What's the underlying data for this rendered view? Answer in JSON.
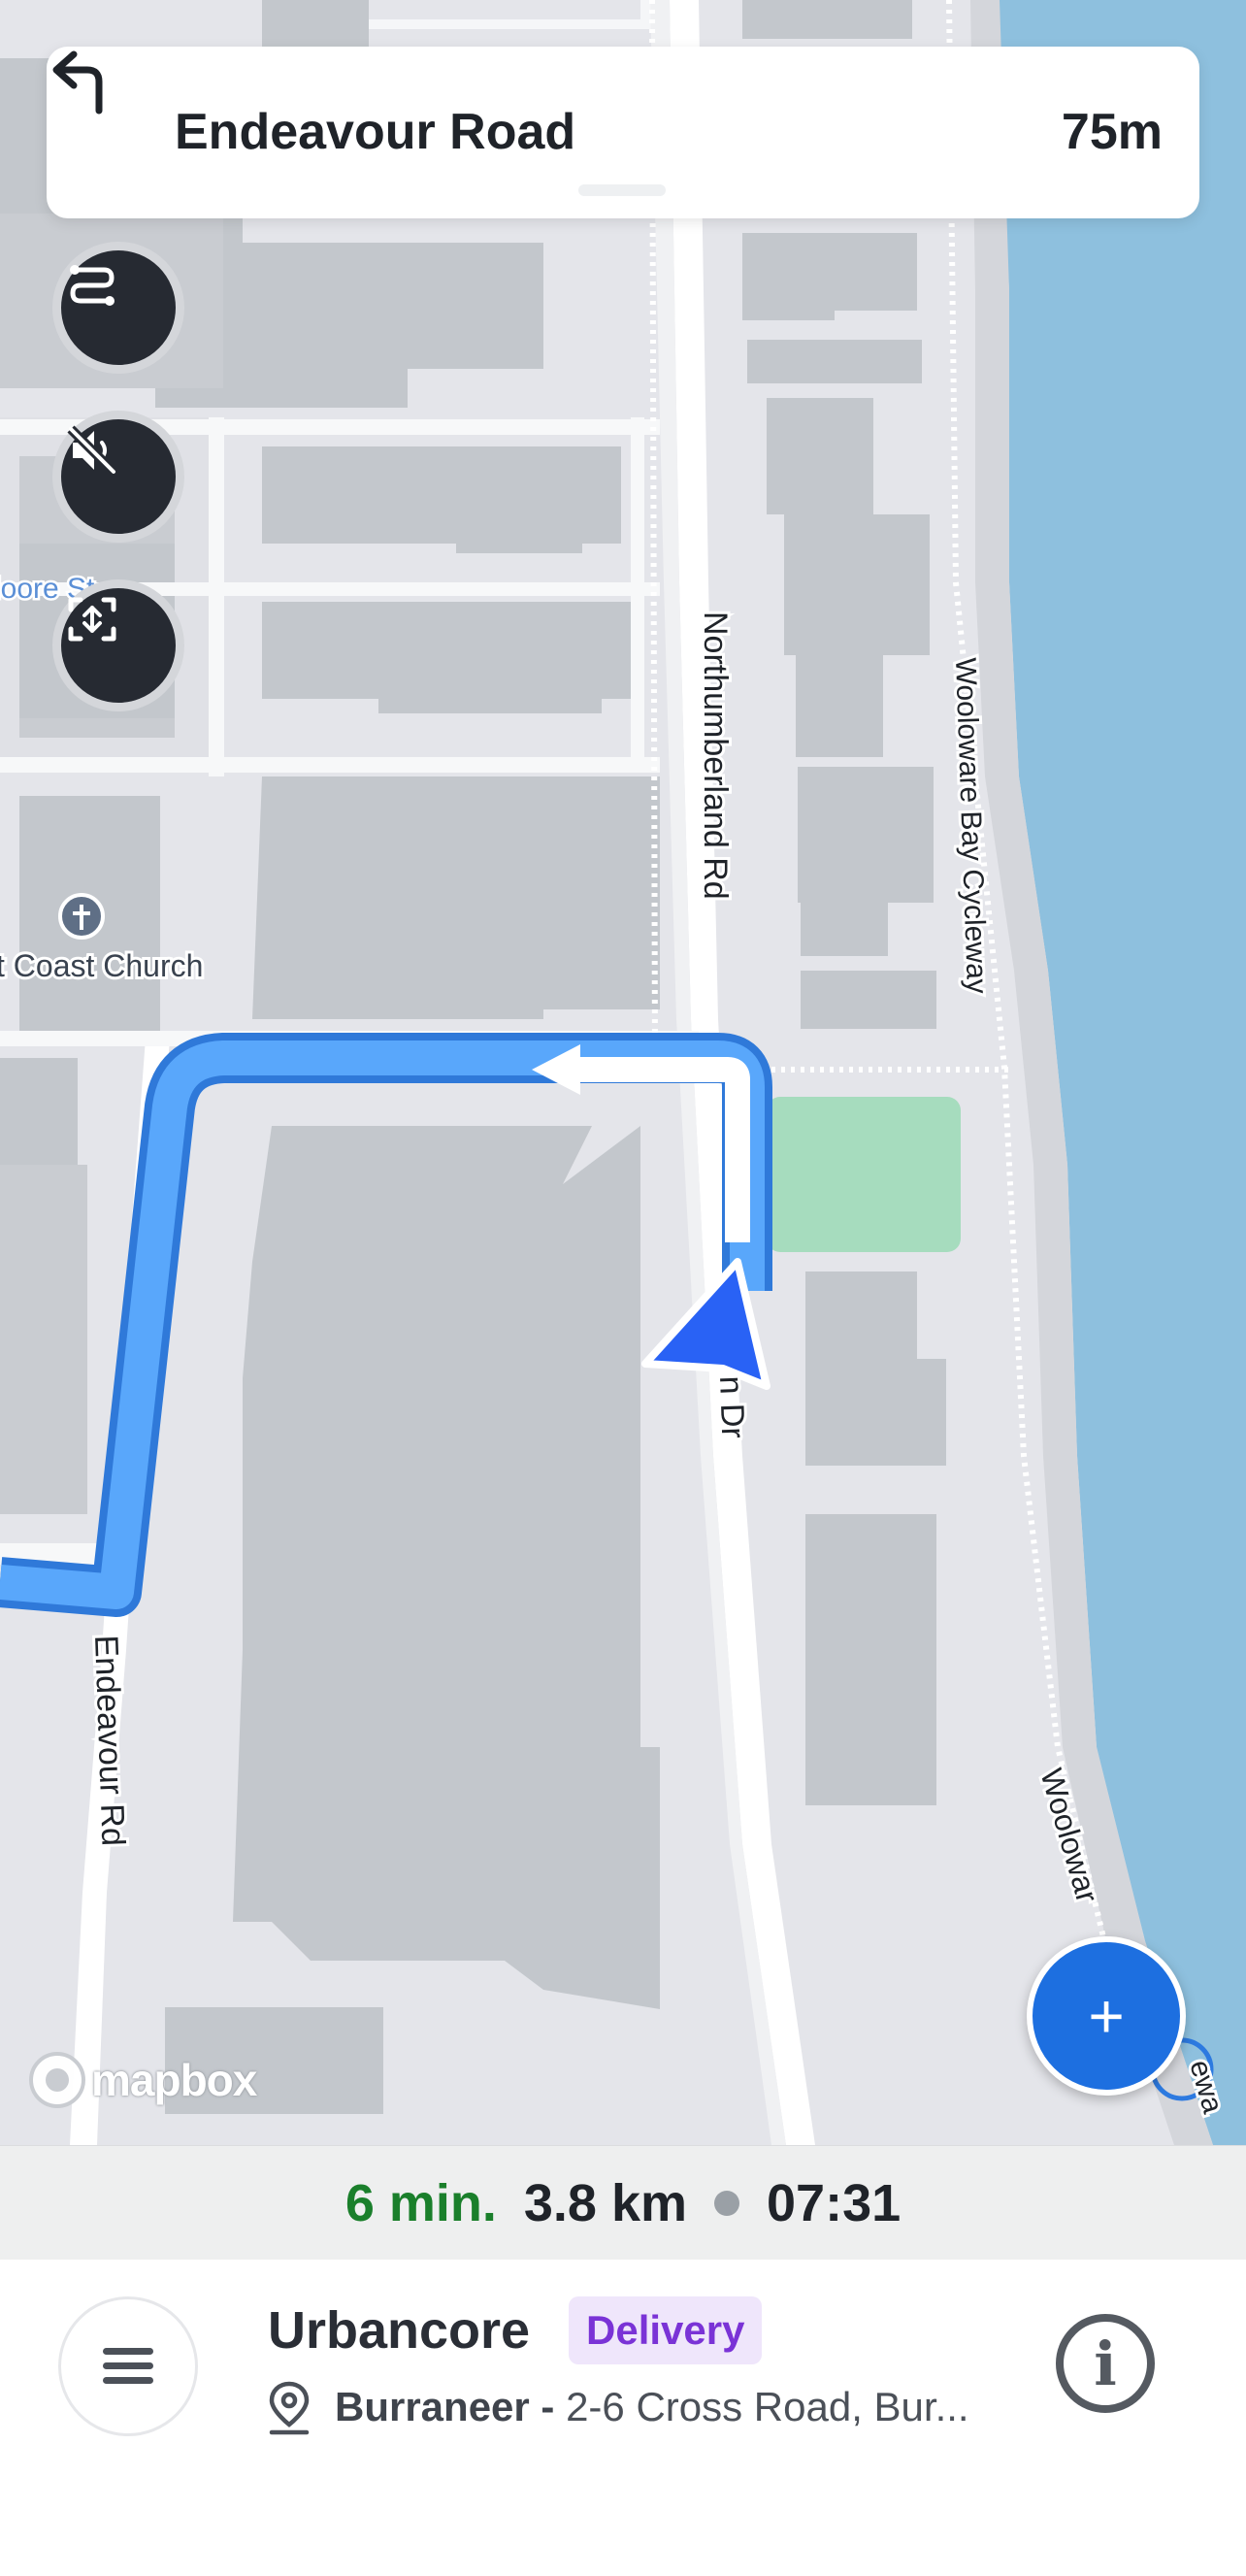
{
  "map": {
    "street_labels": [
      "Northumberland Rd",
      "Wooloware Bay Cycleway",
      "Endeavour Rd",
      "n Dr",
      "loore St",
      "t Coast Church",
      "Woolowar",
      "ewa"
    ],
    "attribution": "mapbox",
    "colors": {
      "route": "#4a9af5",
      "route_outline": "#2f79d9",
      "water": "#8ec0de",
      "park": "#a6dcbe",
      "building": "#c3c7cc",
      "land": "#e4e5ea",
      "puck": "#2962f5"
    }
  },
  "banner": {
    "turn_icon": "turn-left-arrow-icon",
    "street": "Endeavour Road",
    "distance": "75m"
  },
  "controls": [
    {
      "name": "route-overview-button",
      "icon": "route-icon"
    },
    {
      "name": "mute-button",
      "icon": "speaker-muted-icon"
    },
    {
      "name": "recenter-button",
      "icon": "recenter-icon"
    }
  ],
  "fab": {
    "label": "+",
    "icon": "plus-icon"
  },
  "summary": {
    "duration": "6 min.",
    "distance": "3.8 km",
    "eta": "07:31"
  },
  "stop": {
    "company": "Urbancore",
    "type_badge": "Delivery",
    "suburb": "Burraneer -",
    "address": "2-6 Cross Road, Bur..."
  }
}
